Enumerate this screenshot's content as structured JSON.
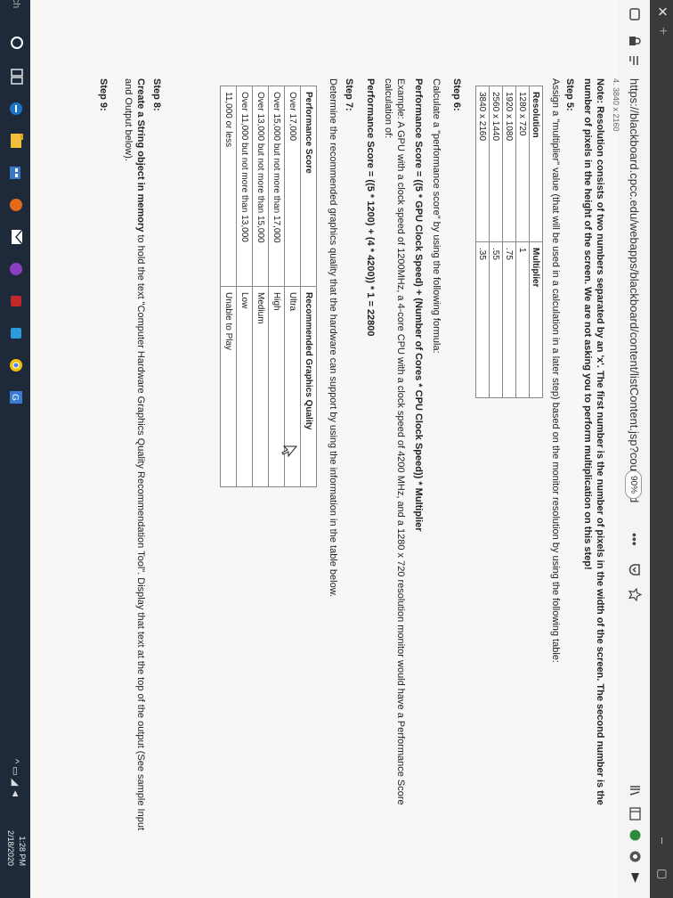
{
  "browser": {
    "tab_close": "✕",
    "new_tab": "+",
    "url": "https://blackboard.cpcc.edu/webapps/blackboard/content/listContent.jsp?course_id",
    "zoom": "90%",
    "more": "•••",
    "win_min": "–",
    "win_max": "▢"
  },
  "content": {
    "cutoff_line": "4. 3840 x 2160",
    "note_line1": "Note: Resolution consists of two numbers separated by an 'x'. The first number is the number of pixels in the width of the screen. The second number is the",
    "note_line2": "number of pixels in the height of the screen. We are not asking you to perform multiplication on this step!",
    "step5_title": "Step 5:",
    "step5_text": "Assign a \"multiplier\" value (that will be used in a calculation in a later step) based on the monitor resolution by using the following table:",
    "resolution_table": {
      "headers": [
        "Resolution",
        "Multiplier"
      ],
      "rows": [
        [
          "1280 x 720",
          "1"
        ],
        [
          "1920 x 1080",
          ".75"
        ],
        [
          "2560 x 1440",
          ".55"
        ],
        [
          "3840 x 2160",
          ".35"
        ]
      ]
    },
    "step6_title": "Step 6:",
    "step6_text": "Calculate a \"performance score\" by using the following formula:",
    "formula": "Performance Score = ((5 * GPU Clock Speed) + (Number of Cores * CPU Clock Speed)) * Multiplier",
    "example_line1": "Example: A GPU with a clock speed of 1200MHz, a 4-core CPU with a clock speed of 4200 MHz, and a 1280 x 720 resolution monitor would have a Performance Score",
    "example_line2": "calculation of:",
    "example_calc": "Performance Score = ((5 * 1200) + (4 * 4200)) * 1 = 22800",
    "step7_title": "Step 7:",
    "step7_text": "Determine the recommended graphics quality that the hardware can support by using the information in the table below.",
    "quality_table": {
      "headers": [
        "Performance Score",
        "Recommended Graphics Quality"
      ],
      "rows": [
        [
          "Over 17,000",
          "Ultra"
        ],
        [
          "Over 15,000 but not more than 17,000",
          "High"
        ],
        [
          "Over 13,000 but not more than 15,000",
          "Medium"
        ],
        [
          "Over 11,000 but not more than 13,000",
          "Low"
        ],
        [
          "11,000 or less",
          "Unable to Play"
        ]
      ]
    },
    "step8_title": "Step 8:",
    "step8_line1_bold": "Create a String object in memory",
    "step8_line1_rest": " to hold the text \"Computer Hardware Graphics Quality Recommendation Tool\". Display that text at the top of the output (See sample Input",
    "step8_line2": "and Output below).",
    "step9_title": "Step 9:"
  },
  "taskbar": {
    "search_hint": "rch",
    "time": "1:28 PM",
    "date": "2/18/2020"
  },
  "colors": {
    "page_bg": "#f7f7f5",
    "taskbar_bg": "#1e2a3a",
    "edge_blue": "#1a73c8",
    "chrome_yellow": "#f4c20d"
  }
}
